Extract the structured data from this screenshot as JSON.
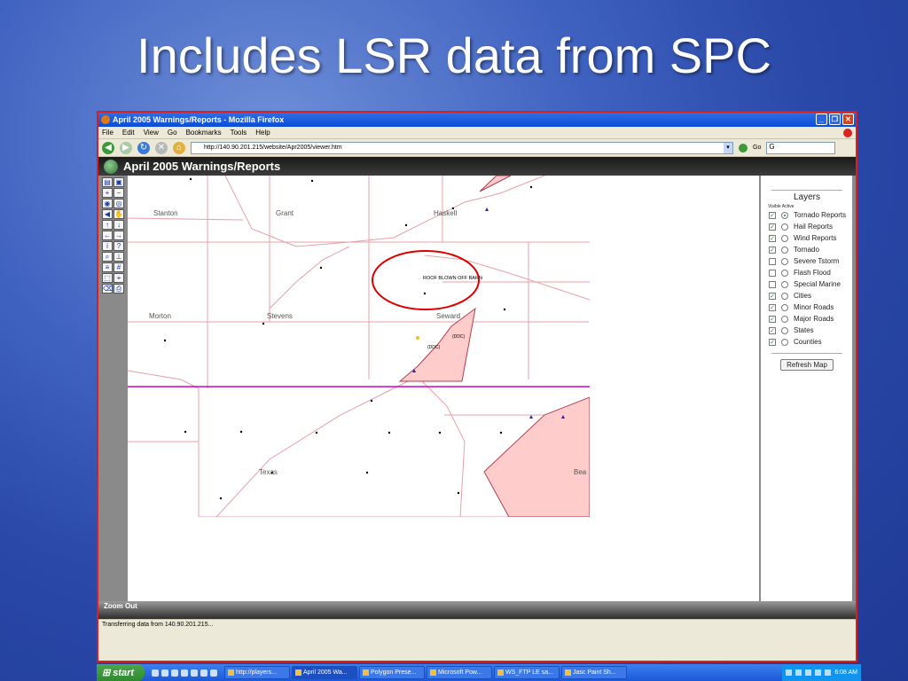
{
  "slide": {
    "title": "Includes LSR data from SPC"
  },
  "browser": {
    "window_title": "April 2005 Warnings/Reports - Mozilla Firefox",
    "menu": [
      "File",
      "Edit",
      "View",
      "Go",
      "Bookmarks",
      "Tools",
      "Help"
    ],
    "url": "http://140.90.201.215/website/Apr2005/viewer.htm",
    "go_label": "Go",
    "search_value": "G",
    "status": "Transferring data from 140.90.201.215..."
  },
  "app": {
    "header": "April 2005 Warnings/Reports",
    "footer": "Zoom Out"
  },
  "map": {
    "labels": [
      "Stanton",
      "Grant",
      "Haskell",
      "Morton",
      "Stevens",
      "Seward",
      "Texas",
      "Bea"
    ],
    "annotation": "ROOF BLOWN OFF BARN",
    "ddc1": "(DDC)",
    "ddc2": "(DDC)",
    "warning_color": "#ffcccc",
    "county_line_color": "#e8a0a8",
    "state_line_color": "#cc00cc",
    "highlight_circle_color": "#dd0000"
  },
  "layers": {
    "title": "Layers",
    "sub": "Visible Active",
    "items": [
      {
        "label": "Tornado Reports",
        "visible": true,
        "active": true
      },
      {
        "label": "Hail Reports",
        "visible": true,
        "active": false
      },
      {
        "label": "Wind Reports",
        "visible": true,
        "active": false
      },
      {
        "label": "Tornado",
        "visible": true,
        "active": false
      },
      {
        "label": "Severe Tstorm",
        "visible": false,
        "active": false
      },
      {
        "label": "Flash Flood",
        "visible": false,
        "active": false
      },
      {
        "label": "Special Marine",
        "visible": false,
        "active": false
      },
      {
        "label": "Cities",
        "visible": true,
        "active": false
      },
      {
        "label": "Minor Roads",
        "visible": true,
        "active": false
      },
      {
        "label": "Major Roads",
        "visible": true,
        "active": false
      },
      {
        "label": "States",
        "visible": true,
        "active": false
      },
      {
        "label": "Counties",
        "visible": true,
        "active": false
      }
    ],
    "refresh_label": "Refresh Map"
  },
  "taskbar": {
    "start": "start",
    "tasks": [
      "http://players...",
      "April 2005 Wa...",
      "Polygon Prese...",
      "Microsoft Pow...",
      "WS_FTP LE sa...",
      "Jasc Paint Sh..."
    ],
    "active_task": 1,
    "clock": "6:08 AM"
  }
}
